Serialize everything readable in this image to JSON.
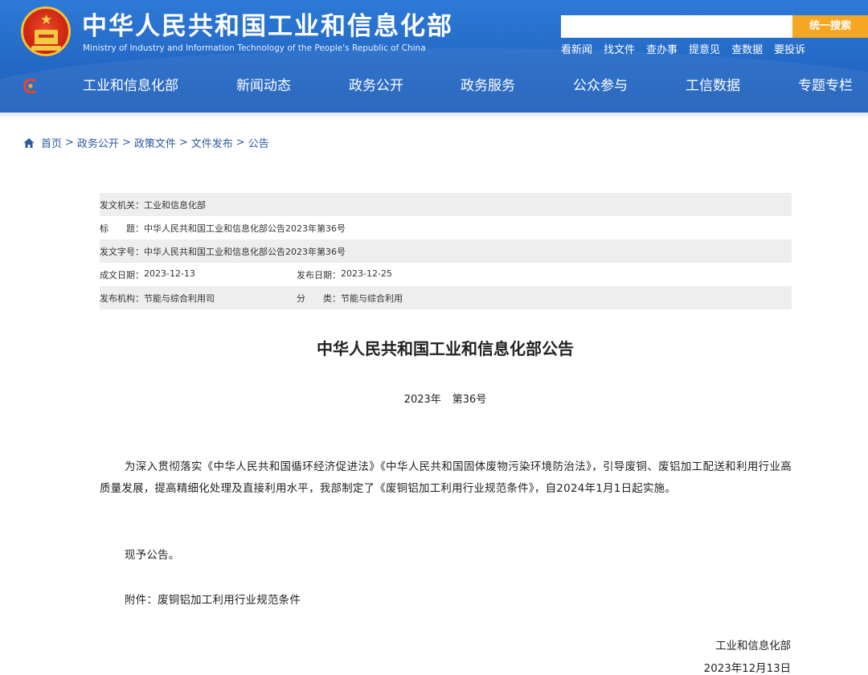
{
  "header": {
    "site_title": "中华人民共和国工业和信息化部",
    "site_subtitle": "Ministry of Industry and Information Technology of the People's Republic of China",
    "search": {
      "placeholder": "",
      "button_label": "统一搜索"
    },
    "quick_links": [
      "看新闻",
      "找文件",
      "查办事",
      "提意见",
      "查数据",
      "要投诉"
    ],
    "nav": [
      "工业和信息化部",
      "新闻动态",
      "政务公开",
      "政务服务",
      "公众参与",
      "工信数据",
      "专题专栏"
    ]
  },
  "breadcrumb": [
    "首页",
    "政务公开",
    "政策文件",
    "文件发布",
    "公告"
  ],
  "breadcrumb_separator": ">",
  "meta": {
    "issuer_label": "发文机关：",
    "issuer": "工业和信息化部",
    "title_label": "标　　题：",
    "title": "中华人民共和国工业和信息化部公告2023年第36号",
    "doc_no_label": "发文字号：",
    "doc_no": "中华人民共和国工业和信息化部公告2023年第36号",
    "written_date_label": "成文日期：",
    "written_date": "2023-12-13",
    "publish_date_label": "发布日期：",
    "publish_date": "2023-12-25",
    "org_label": "发布机构：",
    "org": "节能与综合利用司",
    "category_label": "分　　类：",
    "category": "节能与综合利用"
  },
  "document": {
    "title": "中华人民共和国工业和信息化部公告",
    "year": "2023年",
    "number": "第36号",
    "paragraph1": "为深入贯彻落实《中华人民共和国循环经济促进法》《中华人民共和国固体废物污染环境防治法》，引导废铜、废铝加工配送和利用行业高质量发展，提高精细化处理及直接利用水平，我部制定了《废铜铝加工利用行业规范条件》，自2024年1月1日起实施。",
    "paragraph2": "现予公告。",
    "attachment_label": "附件：",
    "attachment": "废铜铝加工利用行业规范条件",
    "signature": "工业和信息化部",
    "sign_date": "2023年12月13日"
  },
  "colors": {
    "header_blue": "#2469c6",
    "search_button": "#f5a623",
    "breadcrumb_link": "#2c5aa0",
    "meta_row_shade": "#eeeeee"
  }
}
